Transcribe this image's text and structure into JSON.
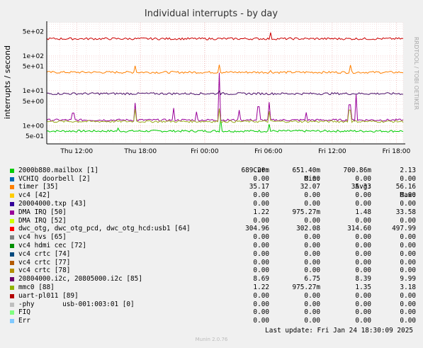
{
  "chart_data": {
    "type": "line",
    "title": "Individual interrupts - by day",
    "ylabel": "interrupts / second",
    "side_label": "RRDTOOL / TOBI OETIKER",
    "yscale": "log",
    "ylim": [
      0.3,
      900
    ],
    "y_ticks": [
      {
        "label": "5e+02",
        "value": 500
      },
      {
        "label": "1e+02",
        "value": 100
      },
      {
        "label": "5e+01",
        "value": 50
      },
      {
        "label": "1e+01",
        "value": 10
      },
      {
        "label": "5e+00",
        "value": 5
      },
      {
        "label": "1e+00",
        "value": 1
      },
      {
        "label": "5e-01",
        "value": 0.5
      }
    ],
    "x_ticks": [
      "Thu 12:00",
      "Thu 18:00",
      "Fri 00:00",
      "Fri 06:00",
      "Fri 12:00",
      "Fri 18:00"
    ],
    "grid": true,
    "series": [
      {
        "name": "2000b880.mailbox [1]",
        "color": "#00cc00",
        "base": 0.7,
        "spikes": [
          {
            "x": 0.488,
            "v": 1.6
          },
          {
            "x": 0.625,
            "v": 1.1
          },
          {
            "x": 0.2,
            "v": 0.85
          }
        ]
      },
      {
        "name": "timer [35]",
        "color": "#ff8000",
        "base": 34,
        "spikes": [
          {
            "x": 0.247,
            "v": 52
          },
          {
            "x": 0.485,
            "v": 56
          },
          {
            "x": 0.851,
            "v": 55
          },
          {
            "x": 0.627,
            "v": 38
          }
        ]
      },
      {
        "name": "DMA IRQ [50]",
        "color": "#990099",
        "base": 1.45,
        "spikes": [
          {
            "x": 0.484,
            "v": 33
          },
          {
            "x": 0.247,
            "v": 4.5
          },
          {
            "x": 0.074,
            "v": 2.3
          },
          {
            "x": 0.357,
            "v": 3.2
          },
          {
            "x": 0.42,
            "v": 2.5
          },
          {
            "x": 0.54,
            "v": 2.8
          },
          {
            "x": 0.594,
            "v": 3.5
          },
          {
            "x": 0.625,
            "v": 4.7
          },
          {
            "x": 0.728,
            "v": 2.4
          },
          {
            "x": 0.85,
            "v": 4.0
          },
          {
            "x": 0.868,
            "v": 8.0
          }
        ]
      },
      {
        "name": "dwc_otg, dwc_otg_pcd, dwc_otg_hcd:usb1 [64]",
        "color": "#cc0000",
        "base": 312,
        "spikes": [
          {
            "x": 0.628,
            "v": 470
          },
          {
            "x": 0.8,
            "v": 320
          }
        ]
      },
      {
        "name": "20804000.i2c, 20805000.i2c [85]",
        "color": "#4a0d68",
        "base": 8.3,
        "spikes": [
          {
            "x": 0.485,
            "v": 9.9
          }
        ]
      },
      {
        "name": "mmc0 [88]",
        "color": "#9caa1e",
        "base": 1.32,
        "spikes": [
          {
            "x": 0.484,
            "v": 3.1
          },
          {
            "x": 0.247,
            "v": 3.0
          },
          {
            "x": 0.625,
            "v": 2.6
          },
          {
            "x": 0.85,
            "v": 2.8
          }
        ]
      }
    ]
  },
  "legend": {
    "headers": [
      "Cur:",
      "Min:",
      "Avg:",
      "Max:"
    ],
    "rows": [
      {
        "label": "2000b880.mailbox [1]",
        "color": "#00cc00",
        "cur": "689.20m",
        "min": "651.40m",
        "avg": "700.86m",
        "max": "2.13"
      },
      {
        "label": "VCHIQ doorbell [2]",
        "color": "#0066b3",
        "cur": "0.00",
        "min": "0.00",
        "avg": "0.00",
        "max": "0.00"
      },
      {
        "label": "timer [35]",
        "color": "#ff8000",
        "cur": "35.17",
        "min": "32.07",
        "avg": "35.33",
        "max": "56.16"
      },
      {
        "label": "vc4 [42]",
        "color": "#ffcc00",
        "cur": "0.00",
        "min": "0.00",
        "avg": "0.00",
        "max": "0.00"
      },
      {
        "label": "20004000.txp [43]",
        "color": "#330099",
        "cur": "0.00",
        "min": "0.00",
        "avg": "0.00",
        "max": "0.00"
      },
      {
        "label": "DMA IRQ [50]",
        "color": "#990099",
        "cur": "1.22",
        "min": "975.27m",
        "avg": "1.48",
        "max": "33.58"
      },
      {
        "label": "DMA IRQ [52]",
        "color": "#ccff00",
        "cur": "0.00",
        "min": "0.00",
        "avg": "0.00",
        "max": "0.00"
      },
      {
        "label": "dwc_otg, dwc_otg_pcd, dwc_otg_hcd:usb1 [64]",
        "color": "#ff0000",
        "cur": "304.96",
        "min": "302.08",
        "avg": "314.60",
        "max": "497.99"
      },
      {
        "label": "vc4 hvs [65]",
        "color": "#808080",
        "cur": "0.00",
        "min": "0.00",
        "avg": "0.00",
        "max": "0.00"
      },
      {
        "label": "vc4 hdmi cec [72]",
        "color": "#008f00",
        "cur": "0.00",
        "min": "0.00",
        "avg": "0.00",
        "max": "0.00"
      },
      {
        "label": "vc4 crtc [74]",
        "color": "#00487d",
        "cur": "0.00",
        "min": "0.00",
        "avg": "0.00",
        "max": "0.00"
      },
      {
        "label": "vc4 crtc [77]",
        "color": "#b35a00",
        "cur": "0.00",
        "min": "0.00",
        "avg": "0.00",
        "max": "0.00"
      },
      {
        "label": "vc4 crtc [78]",
        "color": "#b38f00",
        "cur": "0.00",
        "min": "0.00",
        "avg": "0.00",
        "max": "0.00"
      },
      {
        "label": "20804000.i2c, 20805000.i2c [85]",
        "color": "#6b006b",
        "cur": "8.69",
        "min": "6.75",
        "avg": "8.39",
        "max": "9.99"
      },
      {
        "label": "mmc0 [88]",
        "color": "#8fb300",
        "cur": "1.22",
        "min": "975.27m",
        "avg": "1.35",
        "max": "3.18"
      },
      {
        "label": "uart-pl011 [89]",
        "color": "#b30000",
        "cur": "0.00",
        "min": "0.00",
        "avg": "0.00",
        "max": "0.00"
      },
      {
        "label": "-phy       usb-001:003:01 [0]",
        "color": "#bebebe",
        "cur": "0.00",
        "min": "0.00",
        "avg": "0.00",
        "max": "0.00"
      },
      {
        "label": "FIQ",
        "color": "#80ff80",
        "cur": "0.00",
        "min": "0.00",
        "avg": "0.00",
        "max": "0.00"
      },
      {
        "label": "Err",
        "color": "#80c9ff",
        "cur": "0.00",
        "min": "0.00",
        "avg": "0.00",
        "max": "0.00"
      }
    ]
  },
  "footer": {
    "last_update": "Last update: Fri Jan 24 18:30:09 2025",
    "munin": "Munin 2.0.76"
  }
}
